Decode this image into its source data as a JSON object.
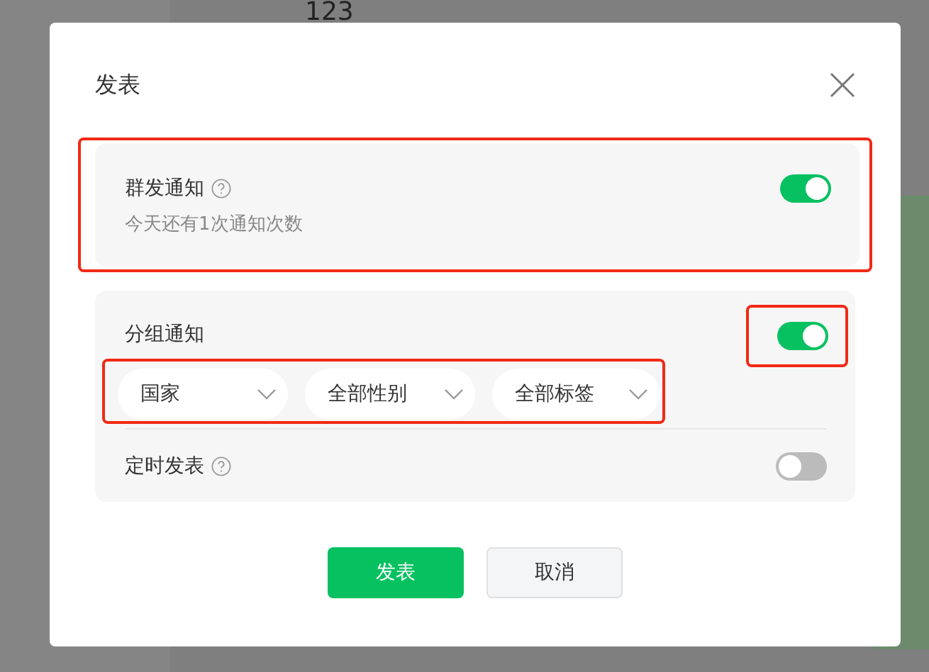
{
  "background_text": "123",
  "dialog": {
    "title": "发表",
    "mass_notice": {
      "label": "群发通知",
      "help": true,
      "subtitle": "今天还有1次通知次数",
      "on": true,
      "highlighted": true
    },
    "group_notice": {
      "label": "分组通知",
      "on": true,
      "toggle_highlighted": true,
      "filters_highlighted": true,
      "filters": [
        {
          "value": "国家"
        },
        {
          "value": "全部性别"
        },
        {
          "value": "全部标签"
        }
      ]
    },
    "scheduled": {
      "label": "定时发表",
      "help": true,
      "on": false
    },
    "buttons": [
      {
        "label": "发表",
        "kind": "primary"
      },
      {
        "label": "取消",
        "kind": "secondary"
      }
    ]
  }
}
